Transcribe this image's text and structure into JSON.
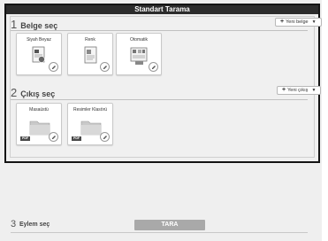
{
  "window": {
    "title": "Standart Tarama"
  },
  "document_section": {
    "number": "1",
    "title": "Belge seç",
    "new_button": {
      "plus": "+",
      "label": "Yeni belge"
    },
    "tiles": [
      {
        "label": "Siyah Beyaz",
        "icon": "document-bw-icon"
      },
      {
        "label": "Renk",
        "icon": "document-color-icon"
      },
      {
        "label": "Otomatik",
        "icon": "document-auto-icon"
      }
    ]
  },
  "output_section": {
    "number": "2",
    "title": "Çıkış seç",
    "new_button": {
      "plus": "+",
      "label": "Yeni çıkış"
    },
    "tiles": [
      {
        "label": "Masaüstü",
        "badge": "PDF",
        "icon": "folder-icon"
      },
      {
        "label": "Resimler Klasörü",
        "badge": "PDF",
        "icon": "folder-icon"
      }
    ]
  },
  "action_section": {
    "number": "3",
    "title": "Eylem seç",
    "scan_button": "TARA"
  },
  "colors": {
    "title_bar": "#2c2c2c",
    "panel_border": "#141414",
    "scan_button": "#a9a9a9",
    "folder": "#c9c9c9"
  }
}
